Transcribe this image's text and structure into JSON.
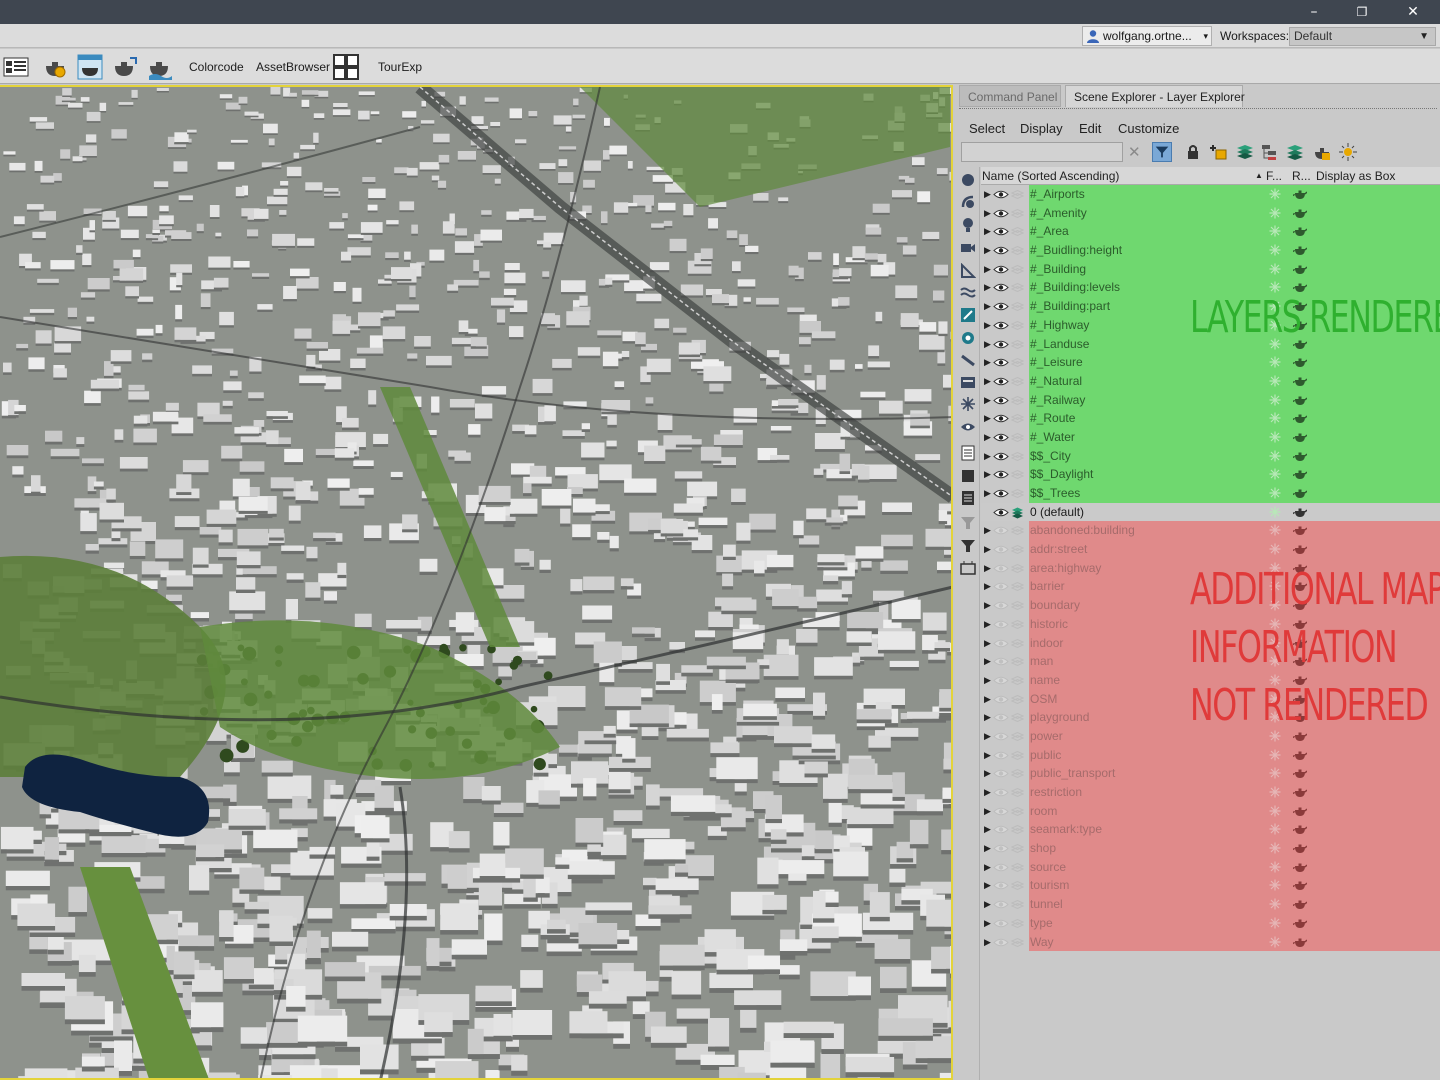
{
  "window": {
    "minimize_glyph": "–",
    "restore_glyph": "❐",
    "close_glyph": "✕"
  },
  "account": {
    "user": "wolfgang.ortne...",
    "caret": "▾",
    "workspaces_label": "Workspaces:",
    "workspace_value": "Default",
    "workspace_caret": "▼"
  },
  "toolbar": {
    "colorcode": "Colorcode",
    "assetbrowser": "AssetBrowser",
    "tourexp": "TourExp"
  },
  "panel": {
    "tab_command": "Command Panel",
    "tab_scene": "Scene Explorer - Layer Explorer",
    "menu_select": "Select",
    "menu_display": "Display",
    "menu_edit": "Edit",
    "menu_customize": "Customize",
    "search_placeholder": "",
    "clear_glyph": "✕",
    "col_name": "Name (Sorted Ascending)",
    "col_sort_glyph": "▲",
    "col_frozen": "F...",
    "col_render": "R...",
    "col_display_box": "Display as Box"
  },
  "layers_rendered": [
    "#_Airports",
    "#_Amenity",
    "#_Area",
    "#_Buidling:height",
    "#_Building",
    "#_Building:levels",
    "#_Building:part",
    "#_Highway",
    "#_Landuse",
    "#_Leisure",
    "#_Natural",
    "#_Railway",
    "#_Route",
    "#_Water",
    "$$_City",
    "$$_Daylight",
    "$$_Trees"
  ],
  "layer_default": "0 (default)",
  "layers_not_rendered": [
    "abandoned:building",
    "addr:street",
    "area:highway",
    "barrier",
    "boundary",
    "historic",
    "indoor",
    "man",
    "name",
    "OSM",
    "playground",
    "power",
    "public",
    "public_transport",
    "restriction",
    "room",
    "seamark:type",
    "shop",
    "source",
    "tourism",
    "tunnel",
    "type",
    "Way"
  ],
  "annotations": {
    "rendered": "LAYERS RENDERED",
    "not_rendered_line1": "ADDITIONAL MAP",
    "not_rendered_line2": "INFORMATION",
    "not_rendered_line3": "NOT RENDERED"
  },
  "colors": {
    "rendered_band": "#6fd86f",
    "not_rendered_band": "#e08a8a",
    "viewport_border": "#e3d33a",
    "annot_green": "#2fb02f",
    "annot_red": "#e03a3a"
  }
}
